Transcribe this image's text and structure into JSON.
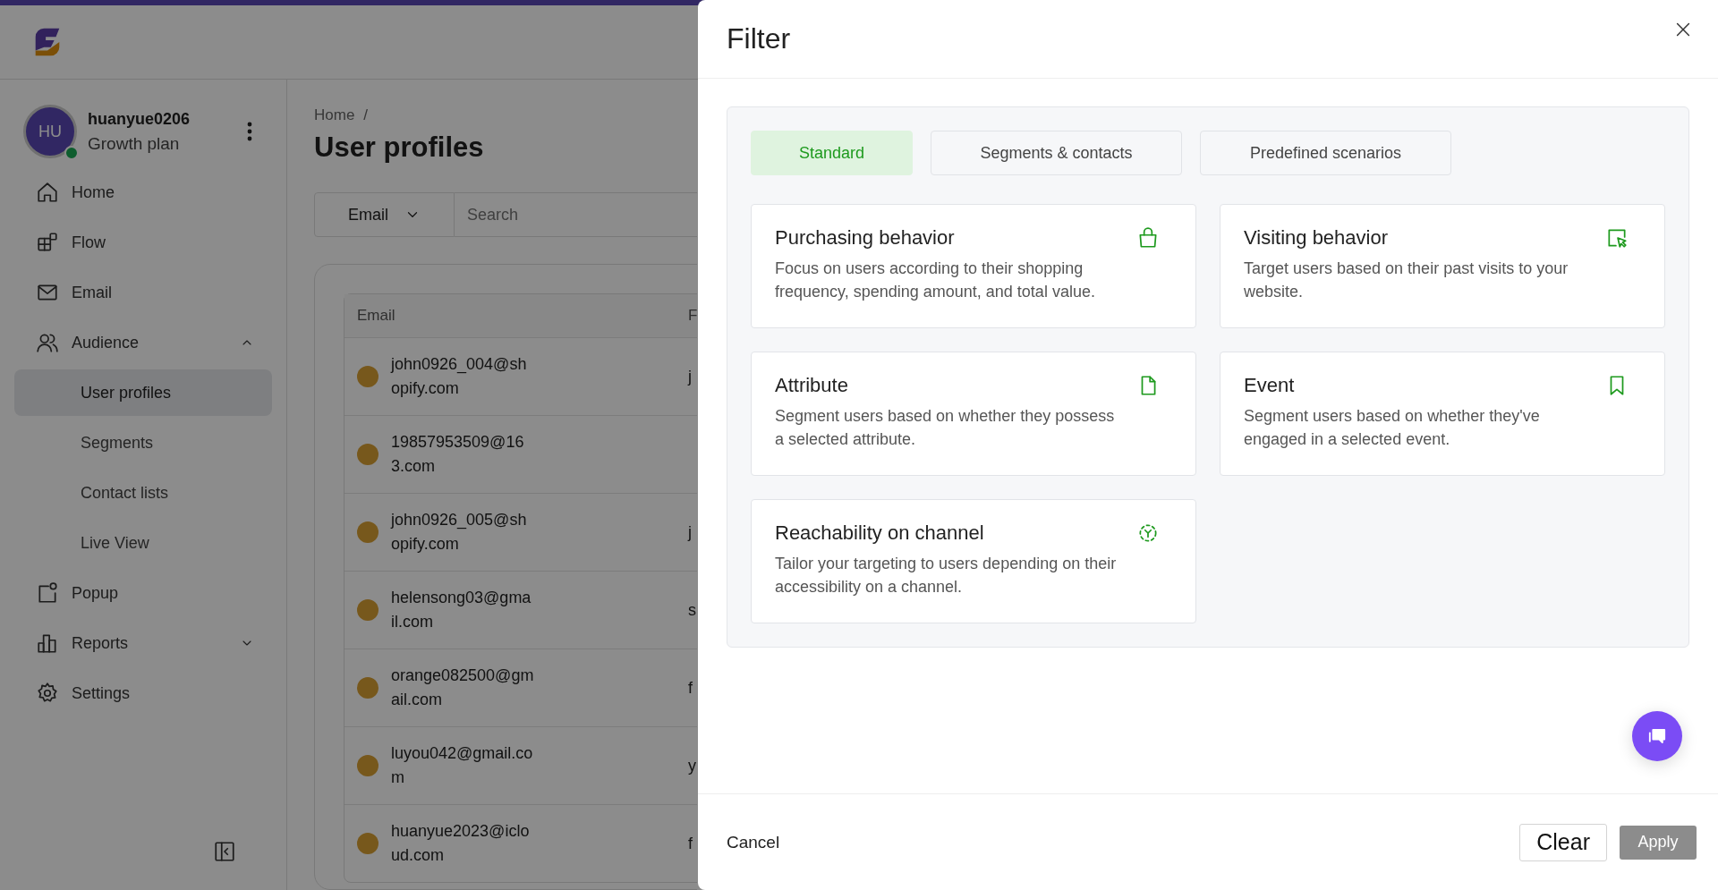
{
  "app": {
    "user": {
      "initials": "HU",
      "name": "huanyue0206",
      "plan": "Growth plan",
      "online": true
    },
    "nav": [
      {
        "label": "Home",
        "kind": "home"
      },
      {
        "label": "Flow",
        "kind": "flow"
      },
      {
        "label": "Email",
        "kind": "email"
      },
      {
        "label": "Audience",
        "kind": "audience",
        "expanded": true,
        "children": [
          {
            "label": "User profiles",
            "selected": true
          },
          {
            "label": "Segments",
            "selected": false
          },
          {
            "label": "Contact lists",
            "selected": false
          },
          {
            "label": "Live View",
            "selected": false
          }
        ]
      },
      {
        "label": "Popup",
        "kind": "popup"
      },
      {
        "label": "Reports",
        "kind": "reports",
        "expanded": false
      },
      {
        "label": "Settings",
        "kind": "settings"
      }
    ]
  },
  "page": {
    "breadcrumb": [
      "Home",
      "/"
    ],
    "title": "User profiles",
    "field_select": "Email",
    "search": {
      "placeholder": "Search"
    },
    "table": {
      "columns": [
        "Email",
        "F"
      ],
      "rows": [
        {
          "email": "john0926_004@shopify.com",
          "column_2": "j"
        },
        {
          "email": "19857953509@163.com",
          "column_2": ""
        },
        {
          "email": "john0926_005@shopify.com",
          "column_2": "j"
        },
        {
          "email": "helensong03@gmail.com",
          "column_2": "s"
        },
        {
          "email": "orange082500@gmail.com",
          "column_2": "f"
        },
        {
          "email": "luyou042@gmail.com",
          "column_2": "y"
        },
        {
          "email": "huanyue2023@icloud.com",
          "column_2": "f"
        }
      ]
    }
  },
  "filter": {
    "title": "Filter",
    "tabs": [
      {
        "label": "Standard",
        "selected": true
      },
      {
        "label": "Segments & contacts",
        "selected": false
      },
      {
        "label": "Predefined scenarios",
        "selected": false
      }
    ],
    "cards": [
      {
        "title": "Purchasing behavior",
        "description": "Focus on users according to their shopping frequency, spending amount, and total value.",
        "kind": "bag"
      },
      {
        "title": "Visiting behavior",
        "description": "Target users based on their past visits to your website.",
        "kind": "cursor"
      },
      {
        "title": "Attribute",
        "description": "Segment users based on whether they possess a selected attribute.",
        "kind": "file"
      },
      {
        "title": "Event",
        "description": "Segment users based on whether they've engaged in a selected event.",
        "kind": "bookmark"
      },
      {
        "title": "Reachability on channel",
        "description": "Tailor your targeting to users depending on their accessibility on a channel.",
        "kind": "target"
      }
    ],
    "footer": {
      "cancel": "Cancel",
      "clear": "Clear",
      "apply": {
        "label": "Apply",
        "disabled": true
      }
    }
  }
}
